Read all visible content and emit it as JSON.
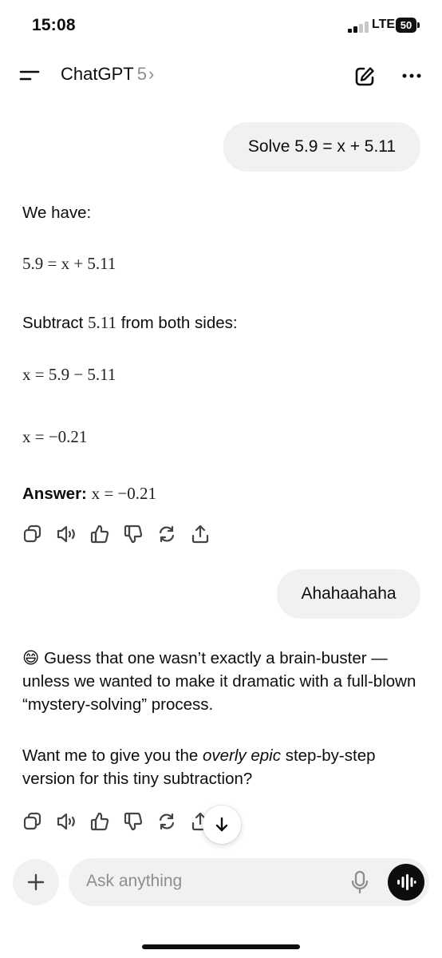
{
  "status": {
    "time": "15:08",
    "network": "LTE",
    "battery": "50"
  },
  "header": {
    "title": "ChatGPT",
    "version": "5",
    "chevron": "›"
  },
  "messages": {
    "user1": "Solve 5.9 = x + 5.11",
    "a1": {
      "intro": "We have:",
      "eq1": "5.9 = x + 5.11",
      "subtract_pre": "Subtract ",
      "subtract_num": "5.11",
      "subtract_post": " from both sides:",
      "eq2": "x = 5.9 − 5.11",
      "eq3": "x = −0.21",
      "answer_label": "Answer:",
      "answer_value": "x = −0.21"
    },
    "user2": "Ahahaahaha",
    "a2": {
      "emoji": "😄",
      "p1": " Guess that one wasn’t exactly a brain-buster — unless we wanted to make it dramatic with a full-blown “mystery-solving” process.",
      "p2_pre": "Want me to give you the ",
      "p2_em": "overly epic",
      "p2_post": " step-by-step version for this tiny subtraction?"
    }
  },
  "composer": {
    "placeholder": "Ask anything"
  },
  "icons": [
    "menu-icon",
    "compose-icon",
    "more-icon",
    "copy-icon",
    "speaker-icon",
    "thumbs-up-icon",
    "thumbs-down-icon",
    "regenerate-icon",
    "share-icon",
    "arrow-down-icon",
    "plus-icon",
    "mic-icon",
    "voice-mode-icon"
  ]
}
